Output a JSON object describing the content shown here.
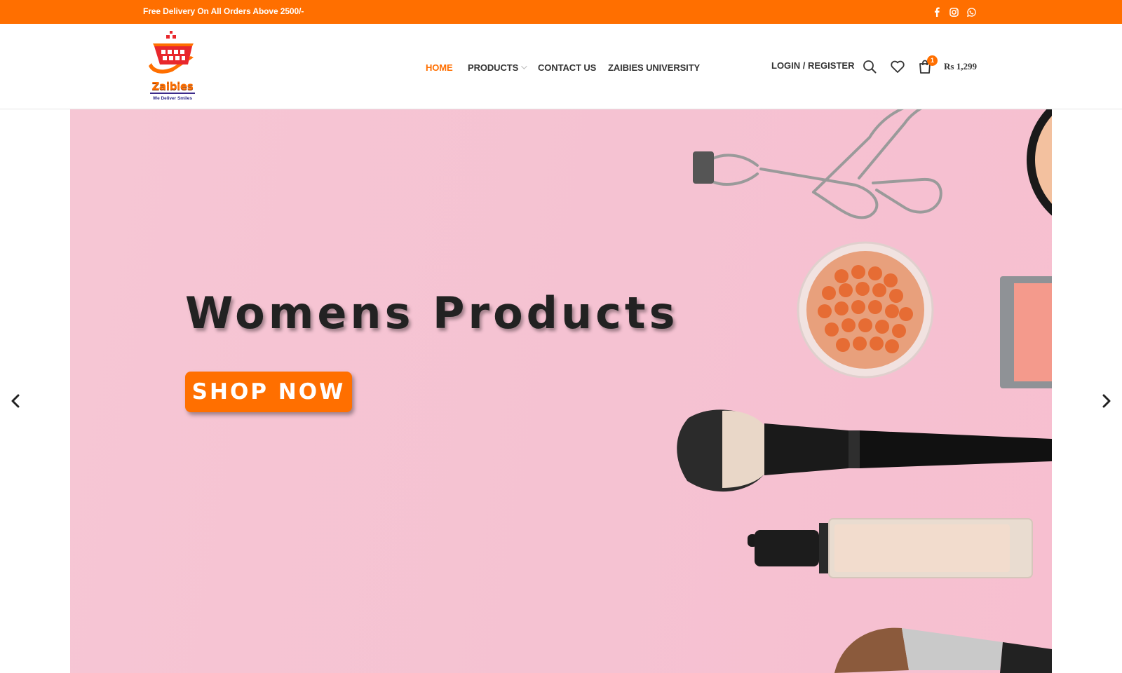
{
  "topbar": {
    "announcement": "Free Delivery On All Orders Above 2500/-",
    "social_icons": [
      "facebook-icon",
      "instagram-icon",
      "whatsapp-icon"
    ]
  },
  "header": {
    "logo": {
      "name": "Zaibies",
      "tagline": "We Deliver Smiles"
    },
    "nav": [
      {
        "label": "HOME",
        "active": true
      },
      {
        "label": "PRODUCTS",
        "has_dropdown": true
      },
      {
        "label": "CONTACT US"
      },
      {
        "label": "ZAIBIES UNIVERSITY"
      }
    ],
    "login_label": "LOGIN / REGISTER",
    "icons": [
      "search-icon",
      "heart-icon",
      "cart-icon"
    ],
    "cart": {
      "count": "1",
      "total": "Rs 1,299"
    }
  },
  "hero": {
    "title": "Womens Products",
    "button_label": "SHOP NOW",
    "prev_icon": "chevron-left-icon",
    "next_icon": "chevron-right-icon"
  },
  "colors": {
    "accent": "#ff6f00",
    "hero_bg": "#f6c6d4",
    "text": "#222222"
  }
}
